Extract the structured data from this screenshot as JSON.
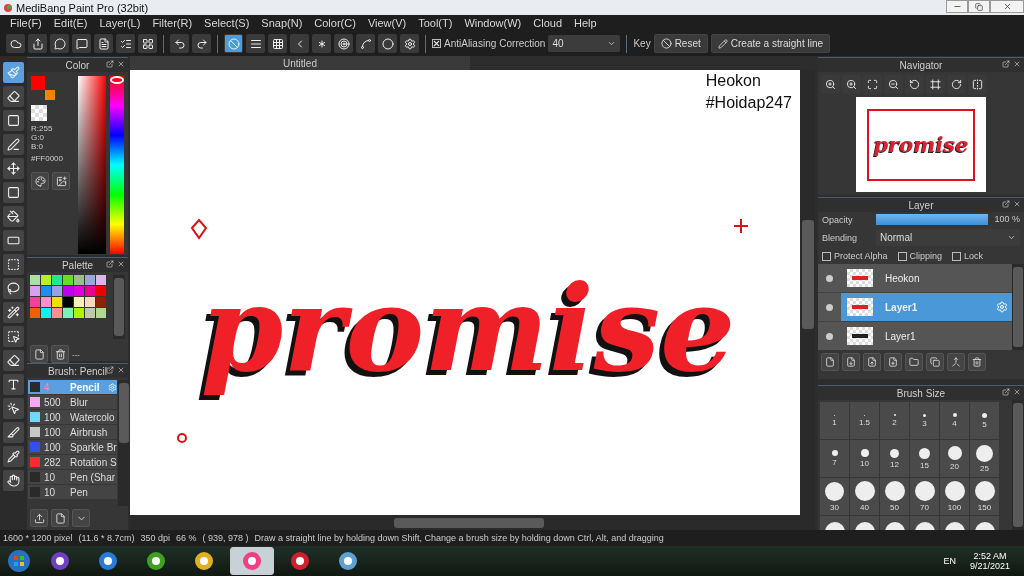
{
  "window": {
    "title": "MediBang Paint Pro (32bit)"
  },
  "menu": [
    "File(F)",
    "Edit(E)",
    "Layer(L)",
    "Filter(R)",
    "Select(S)",
    "Snap(N)",
    "Color(C)",
    "View(V)",
    "Tool(T)",
    "Window(W)",
    "Cloud",
    "Help"
  ],
  "toolbar": {
    "snap": [
      {
        "selected": true
      },
      {
        "selected": false
      },
      {
        "selected": false
      },
      {
        "selected": false
      },
      {
        "selected": false
      },
      {
        "selected": false
      },
      {
        "selected": false
      },
      {
        "selected": false
      },
      {
        "selected": false
      }
    ],
    "antialiasing": {
      "label": "AntiAliasing",
      "checked": true
    },
    "correction": {
      "label": "Correction",
      "value": "40"
    },
    "key_label": "Key",
    "reset": "Reset",
    "straight_line": "Create a straight line"
  },
  "tools": [
    {
      "selected": true
    },
    {
      "selected": false
    },
    {
      "selected": false
    },
    {
      "selected": false
    },
    {
      "selected": false
    },
    {
      "selected": false
    },
    {
      "selected": false
    },
    {
      "selected": false
    },
    {
      "selected": false
    },
    {
      "selected": false
    },
    {
      "selected": false
    },
    {
      "selected": false
    },
    {
      "selected": false
    },
    {
      "selected": false
    },
    {
      "selected": false
    },
    {
      "selected": false
    },
    {
      "selected": false
    },
    {
      "selected": false
    }
  ],
  "color_panel": {
    "title": "Color",
    "foreground": {
      "color": "#ff0000"
    },
    "background": {
      "color": "#ff8000"
    },
    "hue": {
      "level": 1
    },
    "r": "R:255",
    "g": "G:0",
    "b": "B:0",
    "hex": "#FF0000"
  },
  "palette": {
    "title": "Palette",
    "swatches": [
      {
        "color": "#a8e0a8"
      },
      {
        "color": "#b8f020"
      },
      {
        "color": "#20e890"
      },
      {
        "color": "#60e020"
      },
      {
        "color": "#98c088"
      },
      {
        "color": "#98a8d8"
      },
      {
        "color": "#d8b8e8"
      },
      {
        "color": "#d8a0f0"
      },
      {
        "color": "#1890f0"
      },
      {
        "color": "#98a0e8"
      },
      {
        "color": "#c000f0"
      },
      {
        "color": "#e000e0"
      },
      {
        "color": "#f00090"
      },
      {
        "color": "#f00000"
      },
      {
        "color": "#f040a0"
      },
      {
        "color": "#f890d0"
      },
      {
        "color": "#f0e000"
      },
      {
        "color": "#000000"
      },
      {
        "color": "#f8f0b8"
      },
      {
        "color": "#f8d8c0"
      },
      {
        "color": "#902000"
      },
      {
        "color": "#f06000"
      },
      {
        "color": "#10f0f0"
      },
      {
        "color": "#f89090"
      },
      {
        "color": "#80f0b0"
      },
      {
        "color": "#b0f010"
      },
      {
        "color": "#c0c8b0"
      },
      {
        "color": "#b0d890"
      }
    ],
    "name": "---"
  },
  "brush_panel": {
    "title": "Brush: Pencil",
    "brushes": [
      {
        "size": "4",
        "name": "Pencil",
        "color": "#2a2a2a",
        "selected": true
      },
      {
        "size": "500",
        "name": "Blur",
        "color": "#f8a8f0",
        "selected": false
      },
      {
        "size": "100",
        "name": "Watercolo",
        "color": "#70d8f8",
        "selected": false
      },
      {
        "size": "100",
        "name": "Airbrush",
        "color": "#c8c8c8",
        "selected": false
      },
      {
        "size": "100",
        "name": "Sparkle Br",
        "color": "#3050f0",
        "selected": false
      },
      {
        "size": "282",
        "name": "Rotation S",
        "color": "#f03030",
        "selected": false
      },
      {
        "size": "10",
        "name": "Pen (Shar",
        "color": "#2a2a2a",
        "selected": false
      },
      {
        "size": "10",
        "name": "Pen",
        "color": "#2a2a2a",
        "selected": false
      }
    ]
  },
  "canvas": {
    "tab": "Untitled",
    "texts": [
      "Heokon",
      "#Hoidap247"
    ],
    "artwork_text": "promise"
  },
  "navigator": {
    "title": "Navigator",
    "preview_text": "promise"
  },
  "layer_panel": {
    "title": "Layer",
    "opacity": {
      "label": "Opacity",
      "level": 1,
      "reading": "100 %"
    },
    "blending": {
      "label": "Blending",
      "value": "Normal"
    },
    "options": [
      {
        "label": "Protect Alpha",
        "checked": false
      },
      {
        "label": "Clipping",
        "checked": false
      },
      {
        "label": "Lock",
        "checked": false
      }
    ],
    "layers": [
      {
        "name": "Heokon",
        "selected": false
      },
      {
        "name": "Layer1",
        "selected": true
      },
      {
        "name": "Layer1",
        "selected": false
      }
    ]
  },
  "brush_size": {
    "title": "Brush Size",
    "sizes": [
      "1",
      "1.5",
      "2",
      "3",
      "4",
      "5",
      "7",
      "10",
      "12",
      "15",
      "20",
      "25",
      "30",
      "40",
      "50",
      "70",
      "100",
      "150"
    ]
  },
  "status_bar": {
    "pixels": "1600 * 1200 pixel",
    "size": "(11.6 * 8.7cm)",
    "dpi": "350 dpi",
    "zoom": "66 %",
    "position": "( 939, 978 )",
    "message": "Draw a straight line by holding down Shift, Change a brush size by holding down Ctrl, Alt, and dragging"
  },
  "taskbar": {
    "apps": [
      {
        "selected": false
      },
      {
        "selected": false
      },
      {
        "selected": false
      },
      {
        "selected": false
      },
      {
        "selected": true
      },
      {
        "selected": false
      },
      {
        "selected": false
      }
    ],
    "language": "EN",
    "time": "2:52 AM",
    "date": "9/21/2021"
  }
}
